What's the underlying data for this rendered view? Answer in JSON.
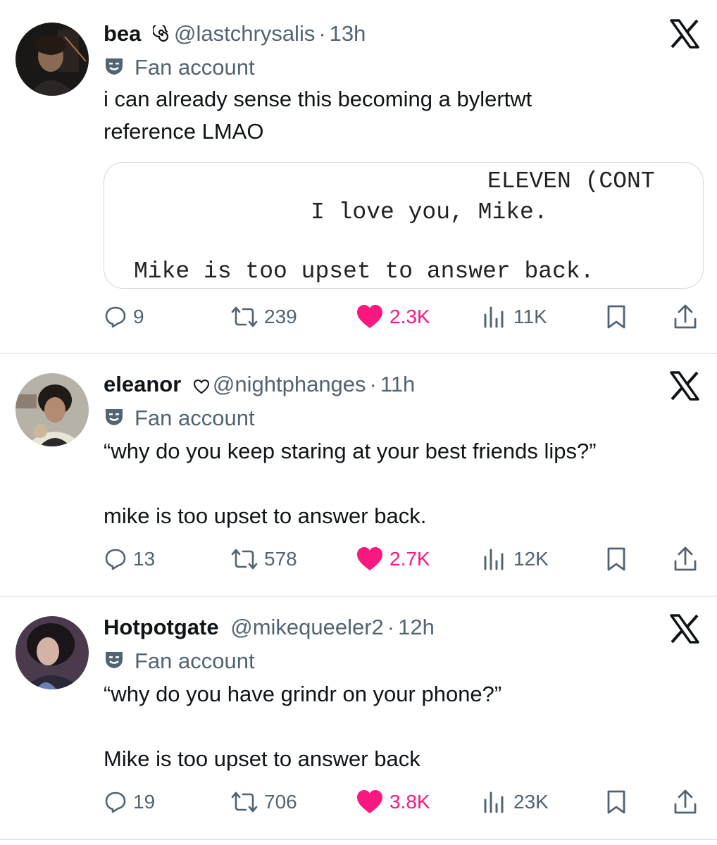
{
  "badge_label": "Fan account",
  "tweets": [
    {
      "name": "bea",
      "handle": "@lastchrysalis",
      "separator": "·",
      "time": "13h",
      "text": "i can already sense this becoming a bylertwt\nreference LMAO",
      "media": {
        "line1": "ELEVEN (CONT",
        "line2": "I love you, Mike.",
        "line3": "Mike is too upset to answer back."
      },
      "replies": "9",
      "retweets": "239",
      "likes": "2.3K",
      "views": "11K"
    },
    {
      "name": "eleanor",
      "handle": "@nightphanges",
      "separator": "·",
      "time": "11h",
      "text": "“why do you keep staring at your best friends lips?”\n\nmike is too upset to answer back.",
      "replies": "13",
      "retweets": "578",
      "likes": "2.7K",
      "views": "12K"
    },
    {
      "name": "Hotpotgate",
      "handle": "@mikequeeler2",
      "separator": "·",
      "time": "12h",
      "text": "“why do you have grindr on your phone?”\n\nMike is too upset to answer back",
      "replies": "19",
      "retweets": "706",
      "likes": "3.8K",
      "views": "23K"
    }
  ],
  "colors": {
    "text": "#0f1419",
    "secondary": "#536471",
    "like": "#f91880",
    "divider": "#cfd9de"
  }
}
